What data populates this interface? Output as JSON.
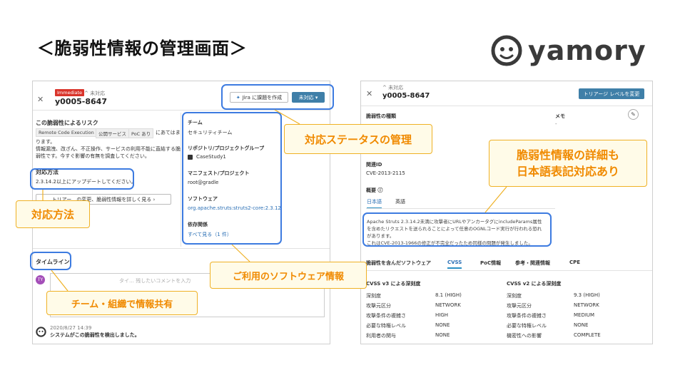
{
  "slide": {
    "title": "＜脆弱性情報の管理画面＞",
    "brand": "yamory"
  },
  "left": {
    "badge": "Immediate",
    "status_small": "^ 未対応",
    "vuln_id": "y0005-8647",
    "jira_button": "Jira に課題を作成",
    "status_button": "未対応 ▾",
    "risk_heading": "この脆弱性によるリスク",
    "risk_chips": [
      "Remote Code Execution",
      "公開サービス",
      "PoC あり"
    ],
    "risk_tail": "にあてはま",
    "risk_text": [
      "ります。",
      "情報漏洩、改ざん、不正操作、サービスの利用不能に直結する脆",
      "弱性です。今すぐ影響の有無を調査してください。"
    ],
    "fix_heading": "対応方法",
    "fix_text": "2.3.14.2以上にアップデートしてください。",
    "more_button": "トリアー…の変更、脆弱性情報を詳しく見る ›",
    "team_label": "チーム",
    "team_value": "セキュリティチーム",
    "repo_label": "リポジトリ/プロジェクトグループ",
    "repo_value": "CaseStudy1",
    "manifest_label": "マニフェスト/プロジェクト",
    "manifest_value": "root@gradle",
    "software_label": "ソフトウェア",
    "software_value": "org.apache.struts:struts2-core:2.3.12",
    "deps_label": "依存関係",
    "deps_link": "すべて見る（1 件）",
    "timeline_heading": "タイムライン",
    "avatar_initials": "TY",
    "comment_placeholder": "タイ… 残したいコメントを入力",
    "log_time": "2020/8/27 14:39",
    "log_text": "システムがこの脆弱性を検出しました。"
  },
  "right": {
    "status_small": "^ 未対応",
    "vuln_id": "y0005-8647",
    "triage_button": "トリアージ レベルを変更",
    "type_label": "脆弱性の種類",
    "memo_label": "メモ",
    "memo_value": "-",
    "related_label": "関連ID",
    "related_value": "CVE-2013-2115",
    "overview_label": "概要 ⓘ",
    "lang_tabs": [
      "日本語",
      "英語"
    ],
    "desc": [
      "Apache Struts 2.3.14.2未満に攻撃者にURLやアンカータグにincludeParams属性",
      "を含めたリクエストを送られることによって任意のOGNLコード実行が行われる恐れ",
      "があります。",
      "これはCVE-2013-1966の修正が不完全だったため同様の問題が発生しました。"
    ],
    "detail_tabs": [
      "脆弱性を含んだソフトウェア",
      "CVSS",
      "PoC情報",
      "参考・関連情報",
      "CPE"
    ],
    "cvss3_heading": "CVSS v3 による深刻度",
    "cvss2_heading": "CVSS v2 による深刻度",
    "cvss3_rows": [
      {
        "k": "深刻度",
        "v": "8.1 (HIGH)"
      },
      {
        "k": "攻撃元区分",
        "v": "NETWORK"
      },
      {
        "k": "攻撃条件の複雑さ",
        "v": "HIGH"
      },
      {
        "k": "必要な特権レベル",
        "v": "NONE"
      },
      {
        "k": "利用者の関与",
        "v": "NONE"
      }
    ],
    "cvss2_rows": [
      {
        "k": "深刻度",
        "v": "9.3 (HIGH)"
      },
      {
        "k": "攻撃元区分",
        "v": "NETWORK"
      },
      {
        "k": "攻撃条件の複雑さ",
        "v": "MEDIUM"
      },
      {
        "k": "必要な特権レベル",
        "v": "NONE"
      },
      {
        "k": "機密性への影響",
        "v": "COMPLETE"
      }
    ]
  },
  "callouts": {
    "status": "対応ステータスの管理",
    "method": "対応方法",
    "share": "チーム・組織で情報共有",
    "software": "ご利用のソフトウェア情報",
    "detail_1": "脆弱性情報の詳細も",
    "detail_2": "日本語表記対応あり"
  },
  "colors": {
    "highlight_blue": "#3d7be0",
    "callout_orange": "#f08a00",
    "callout_border": "#efb125",
    "critical_red": "#d9342b",
    "button_blue": "#3f7fa8"
  }
}
